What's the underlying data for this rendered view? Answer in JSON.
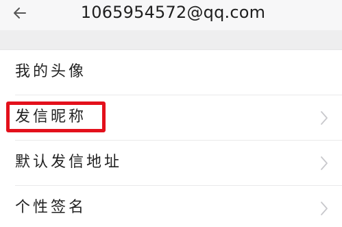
{
  "header": {
    "title": "1065954572@qq.com"
  },
  "settings": {
    "items": [
      {
        "label": "我的头像",
        "has_chevron": false
      },
      {
        "label": "发信昵称",
        "has_chevron": true
      },
      {
        "label": "默认发信地址",
        "has_chevron": true
      },
      {
        "label": "个性签名",
        "has_chevron": true
      }
    ]
  },
  "icons": {
    "back": "arrow-left-icon",
    "chevron": "chevron-right-icon"
  },
  "colors": {
    "highlight_box": "#e3101b",
    "chevron": "#c8c8cc"
  }
}
